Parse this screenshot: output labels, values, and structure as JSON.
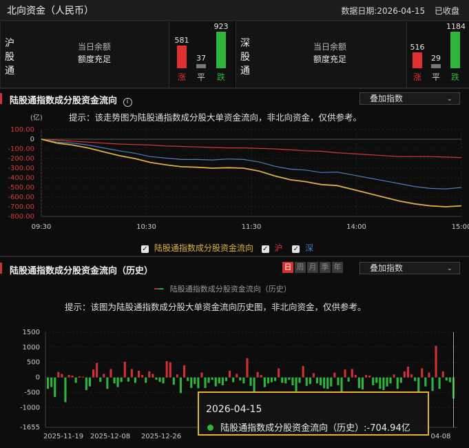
{
  "header": {
    "title": "北向资金（人民币）",
    "date_label": "数据日期:2026-04-15",
    "status": "已收盘"
  },
  "panels": [
    {
      "market": "沪股通",
      "balance_label": "当日余额",
      "balance_value": "额度充足",
      "up": 581,
      "flat": 37,
      "down": 923,
      "up_label": "涨",
      "flat_label": "平",
      "down_label": "跌"
    },
    {
      "market": "深股通",
      "balance_label": "当日余额",
      "balance_value": "额度充足",
      "up": 516,
      "flat": 29,
      "down": 1184,
      "up_label": "涨",
      "flat_label": "平",
      "down_label": "跌"
    }
  ],
  "intraday": {
    "title": "陆股通指数成分股资金流向",
    "info_icon": "info-circle-icon",
    "dropdown": "叠加指数",
    "hint": "提示：该走势图为陆股通指数成分股大单资金流向，非北向资金，仅供参考。",
    "y_unit": "(亿)",
    "legend": {
      "main": "陆股通指数成分股资金流向",
      "sh": "沪",
      "sz": "深"
    },
    "colors": {
      "main": "#e0b23c",
      "sh": "#d63a3a",
      "sz": "#4a7fc0"
    },
    "chart_data": {
      "type": "line",
      "ylim": [
        -800,
        100
      ],
      "yticks": [
        "100.00",
        "0",
        "-100.00",
        "-200.00",
        "-300.00",
        "-400.00",
        "-500.00",
        "-600.00",
        "-700.00",
        "-800.00"
      ],
      "xticks": [
        "09:30",
        "10:30",
        "11:30",
        "14:00",
        "15:00"
      ],
      "series": [
        {
          "name": "陆股通指数成分股资金流向",
          "values": [
            0,
            -40,
            -60,
            -90,
            -130,
            -170,
            -200,
            -240,
            -265,
            -285,
            -290,
            -300,
            -295,
            -300,
            -330,
            -380,
            -420,
            -440,
            -470,
            -480,
            -520,
            -560,
            -600,
            -640,
            -670,
            -690,
            -700,
            -690
          ]
        },
        {
          "name": "沪",
          "values": [
            0,
            -10,
            -20,
            -30,
            -40,
            -50,
            -55,
            -60,
            -70,
            -75,
            -80,
            -85,
            -90,
            -90,
            -95,
            -100,
            -110,
            -120,
            -125,
            -140,
            -150,
            -160,
            -170,
            -180,
            -180,
            -180,
            -185,
            -190
          ]
        },
        {
          "name": "深",
          "values": [
            0,
            -30,
            -40,
            -60,
            -90,
            -120,
            -145,
            -180,
            -195,
            -210,
            -210,
            -215,
            -205,
            -210,
            -235,
            -280,
            -310,
            -320,
            -345,
            -340,
            -370,
            -400,
            -430,
            -460,
            -490,
            -510,
            -515,
            -500
          ]
        }
      ]
    }
  },
  "history": {
    "title": "陆股通指数成分股资金流向（历史）",
    "period_tabs": [
      "日",
      "周",
      "月",
      "季",
      "年"
    ],
    "active_tab": "日",
    "dropdown": "叠加指数",
    "legend": "陆股通指数成分股资金流向（历史）",
    "hint": "提示：该图为陆股通指数成分股大单资金流向历史图，非北向资金，仅供参考。",
    "chart_data": {
      "type": "bar",
      "ylim": [
        -1655,
        1500
      ],
      "yticks": [
        "1500",
        "1000",
        "500",
        "0",
        "-500",
        "-1000",
        "-1655"
      ],
      "xticks": [
        "2025-11-19",
        "2025-12-08",
        "2025-12-26",
        "04-08"
      ],
      "values": [
        -380,
        -320,
        -650,
        180,
        120,
        -820,
        80,
        60,
        -180,
        40,
        20,
        -420,
        -300,
        260,
        480,
        -150,
        120,
        -380,
        280,
        -200,
        -320,
        -150,
        520,
        -140,
        280,
        -180,
        220,
        80,
        -180,
        200,
        120,
        -80,
        -150,
        -200,
        540,
        500,
        -240,
        100,
        -520,
        400,
        -120,
        -350,
        -220,
        -360,
        160,
        -350,
        -180,
        -80,
        -300,
        -200,
        -260,
        -120,
        220,
        -160,
        120,
        -100,
        -200,
        640,
        -280,
        -500,
        180,
        80,
        -320,
        -200,
        -160,
        -120,
        300,
        -180,
        -200,
        -80,
        -260,
        -460,
        -180,
        380,
        -280,
        -220,
        140,
        -200,
        -260,
        -360,
        -380,
        -300,
        160,
        -260,
        -480,
        260,
        -140,
        280,
        80,
        -360,
        -400,
        80,
        60,
        -260,
        -180,
        -380,
        -420,
        -300,
        -200,
        100,
        -380,
        -180,
        200,
        360,
        100,
        -120,
        -520,
        300,
        -300,
        160,
        -450,
        1050,
        -380,
        200,
        -100,
        -160,
        -704.94
      ]
    },
    "tooltip": {
      "date": "2026-04-15",
      "label": "陆股通指数成分股资金流向（历史）",
      "value": ":-704.94亿"
    }
  }
}
